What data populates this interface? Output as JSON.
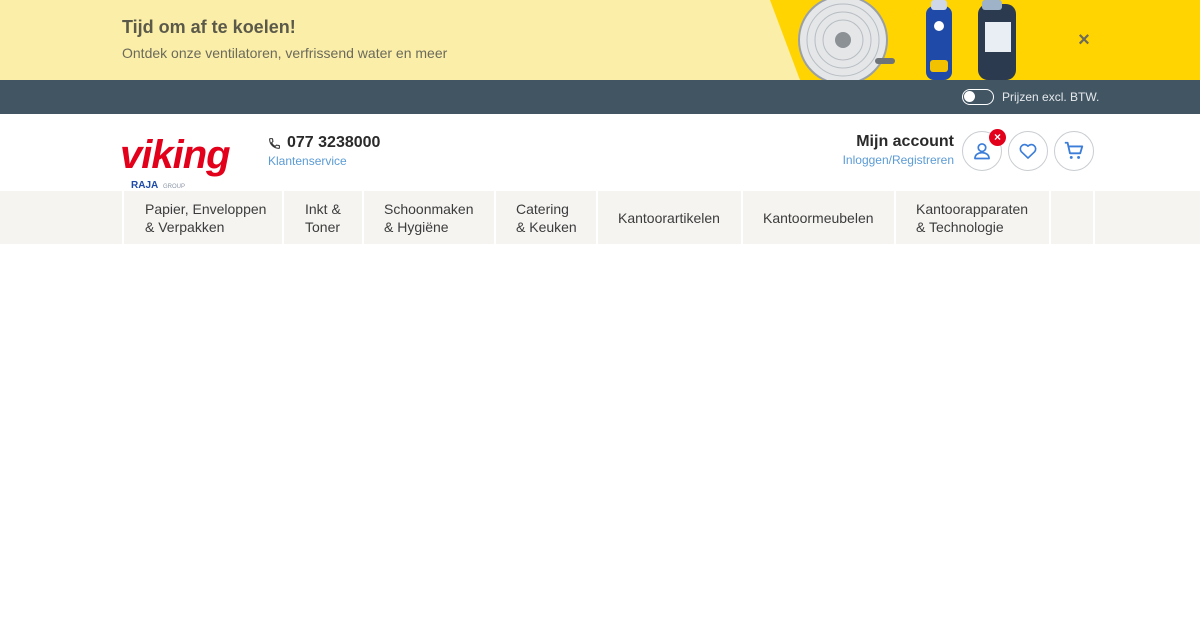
{
  "promo": {
    "title": "Tijd om af te koelen!",
    "subtitle": "Ontdek onze ventilatoren, verfrissend water en meer",
    "close_icon": "×",
    "colors": {
      "background": "#fbeea8",
      "accent": "#ffd400"
    }
  },
  "topbar": {
    "vat_label": "Prijzen excl. BTW.",
    "vat_toggle_on": false
  },
  "header": {
    "logo_text": "viking",
    "logo_sub": "RAJA",
    "logo_sub2": "GROUP",
    "phone": "077 3238000",
    "customer_service": "Klantenservice",
    "account_title": "Mijn account",
    "account_link": "Inloggen/Registreren",
    "account_badge": "×",
    "brand_color": "#e2001a",
    "link_color": "#5b9bd5"
  },
  "nav": {
    "items": [
      {
        "label": "Papier, Enveloppen\n& Verpakken"
      },
      {
        "label": "Inkt &\nToner"
      },
      {
        "label": "Schoonmaken\n& Hygiëne"
      },
      {
        "label": "Catering\n& Keuken"
      },
      {
        "label": "Kantoorartikelen"
      },
      {
        "label": "Kantoormeubelen"
      },
      {
        "label": "Kantoorapparaten\n& Technologie"
      }
    ]
  }
}
